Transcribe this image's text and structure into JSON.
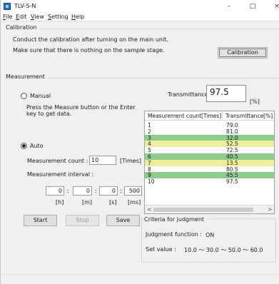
{
  "window": {
    "title": "TLV-S-N",
    "minimize": "–",
    "maximize": "□",
    "close": "×"
  },
  "menu": {
    "file": {
      "key": "F",
      "rest": "ile"
    },
    "edit": {
      "key": "E",
      "rest": "dit"
    },
    "view": {
      "key": "V",
      "rest": "iew"
    },
    "setting": {
      "key": "S",
      "rest": "etting"
    },
    "help": {
      "key": "H",
      "rest": "elp"
    }
  },
  "calibration": {
    "group_title": "Calibration",
    "line1": "Conduct the calibration after turning on the main unit.",
    "line2": "Make sure that there is nothing on the sample stage.",
    "button": "Calibration"
  },
  "measurement": {
    "group_title": "Measurement",
    "manual_label": "Manual",
    "manual_help_1": "Press the Measure button or the Enter",
    "manual_help_2": "key to get data.",
    "transmittance_label": "Transmittance",
    "transmittance_value": "97.5",
    "transmittance_unit": "[%]",
    "auto_label": "Auto",
    "count_label": "Measurement count :",
    "count_value": "10",
    "count_unit": "[Times]",
    "interval_label": "Measurement interval :",
    "interval": {
      "h": "0",
      "m": "0",
      "s": "0",
      "ms": "500",
      "sep": ":",
      "h_unit": "[h]",
      "m_unit": "[m]",
      "s_unit": "[s]",
      "ms_unit": "[ms]"
    },
    "start_button": "Start",
    "stop_button": "Stop",
    "save_button": "Save",
    "manual_selected": false,
    "auto_selected": true
  },
  "table": {
    "col1": "Measurement count[Times]",
    "col2": "Transmittance[%]",
    "rows": [
      {
        "count": "1",
        "value": "79.0",
        "highlight": "none"
      },
      {
        "count": "2",
        "value": "81.0",
        "highlight": "none"
      },
      {
        "count": "3",
        "value": "32.0",
        "highlight": "green"
      },
      {
        "count": "4",
        "value": "52.5",
        "highlight": "yellow"
      },
      {
        "count": "5",
        "value": "72.5",
        "highlight": "none"
      },
      {
        "count": "6",
        "value": "40.5",
        "highlight": "green"
      },
      {
        "count": "7",
        "value": "13.5",
        "highlight": "yellow"
      },
      {
        "count": "8",
        "value": "80.5",
        "highlight": "none"
      },
      {
        "count": "9",
        "value": "45.5",
        "highlight": "green"
      },
      {
        "count": "10",
        "value": "97.5",
        "highlight": "none"
      }
    ],
    "scroll_left": "<",
    "scroll_right": ">"
  },
  "criteria": {
    "group_title": "Criteria for judgment",
    "function_label": "Judgment function :",
    "function_value": "ON",
    "set_label": "Set value :",
    "set_values": "10.0 〜  30.0 〜  50.0 〜  60.0"
  },
  "colors": {
    "green_row": "#8ccc8c",
    "yellow_row": "#eeee9a",
    "app_icon": "#1f6fc5"
  }
}
